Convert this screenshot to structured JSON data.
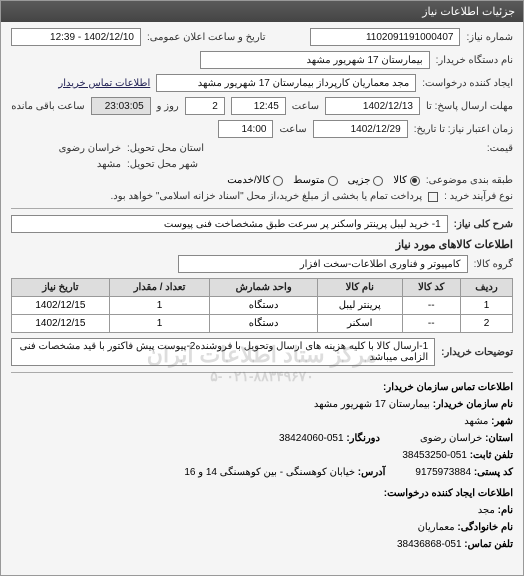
{
  "titlebar": "جزئیات اطلاعات نیاز",
  "labels": {
    "reqNo": "شماره نیاز:",
    "announceDate": "تاریخ و ساعت اعلان عمومی:",
    "buyerName": "نام دستگاه خریدار:",
    "requester": "ایجاد کننده درخواست:",
    "buyerContact": "اطلاعات تماس خریدار",
    "deadlineFrom": "مهلت ارسال پاسخ: تا",
    "time1": "ساعت",
    "daysAnd": "روز و",
    "remain": "ساعت باقی مانده",
    "validTo": "زمان اعتبار نیاز: تا تاریخ:",
    "time2": "ساعت",
    "price": "قیمت:",
    "province": "استان محل تحویل:",
    "city": "شهر محل تحویل:",
    "category": "طبقه بندی موضوعی:",
    "goods": "کالا",
    "partial": "جزیی",
    "medium": " متوسط",
    "service": "کالا/خدمت",
    "buyType": "نوع فرآیند خرید :",
    "buyTypeNote": "پرداخت تمام یا بخشی از مبلغ خرید،از محل \"اسناد خزانه اسلامی\" خواهد بود.",
    "overallDesc": "شرح کلی نیاز:",
    "itemsInfo": "اطلاعات کالاهای مورد نیاز",
    "goodsGroup": "گروه کالا:",
    "buyerNotes": "توضیحات خریدار:",
    "contactHeader": "اطلاعات تماس سازمان خریدار:",
    "orgName": "نام سازمان خریدار:",
    "c_city": "شهر:",
    "c_province": "استان:",
    "c_fax": "دورنگار:",
    "c_phone": "تلفن ثابت:",
    "c_postal": "کد پستی:",
    "c_address": "آدرس:",
    "requesterHeader": "اطلاعات ایجاد کننده درخواست:",
    "r_fname": "نام:",
    "r_lname": "نام خانوادگی:",
    "r_phone": "تلفن تماس:"
  },
  "values": {
    "reqNo": "1102091191000407",
    "announceDate": "1402/12/10 - 12:39",
    "buyerName": "بیمارستان 17 شهریور مشهد",
    "requester": "مجد معماریان کارپرداز بیمارستان 17 شهریور مشهد",
    "deadlineDate": "1402/12/13",
    "deadlineTime": "12:45",
    "days": "2",
    "remainTime": "23:03:05",
    "validDate": "1402/12/29",
    "validTime": "14:00",
    "province": "خراسان رضوی",
    "city": "مشهد",
    "overallDesc": "1- خرید لیبل پرینتر واسکنر پر سرعت طبق مشخصاخت فنی پیوست",
    "goodsGroup": "کامپیوتر و فناوری اطلاعات-سخت افزار",
    "buyerNotes": "1-ارسال کالا با کلیه هزینه های ارسال وتحویل با فروشنده2-پیوست پیش فاکتور با قید مشخصات فنی الزامی میباشد"
  },
  "tableHeaders": [
    "ردیف",
    "کد کالا",
    "نام کالا",
    "واحد شمارش",
    "تعداد / مقدار",
    "تاریخ نیاز"
  ],
  "tableRows": [
    {
      "rn": "1",
      "code": "--",
      "name": "پرینتر لیبل",
      "unit": "دستگاه",
      "qty": "1",
      "date": "1402/12/15"
    },
    {
      "rn": "2",
      "code": "--",
      "name": "اسکنر",
      "unit": "دستگاه",
      "qty": "1",
      "date": "1402/12/15"
    }
  ],
  "contact": {
    "orgName": "بیمارستان 17 شهریور مشهد",
    "city": "مشهد",
    "province": "خراسان رضوی",
    "fax": "051-38424060",
    "phone": "051-38453250",
    "postal": "9175973884",
    "address": "خیابان کوهسنگی - بین کوهسنگی 14 و 16",
    "r_fname": "مجد",
    "r_lname": "معماریان",
    "r_phone": "051-38436868"
  },
  "watermark": {
    "l1": "مرکز ستاد اطلاعات ایران",
    "l2": "۰۲۱-۸۸۳۴۹۶۷۰ -۵"
  }
}
